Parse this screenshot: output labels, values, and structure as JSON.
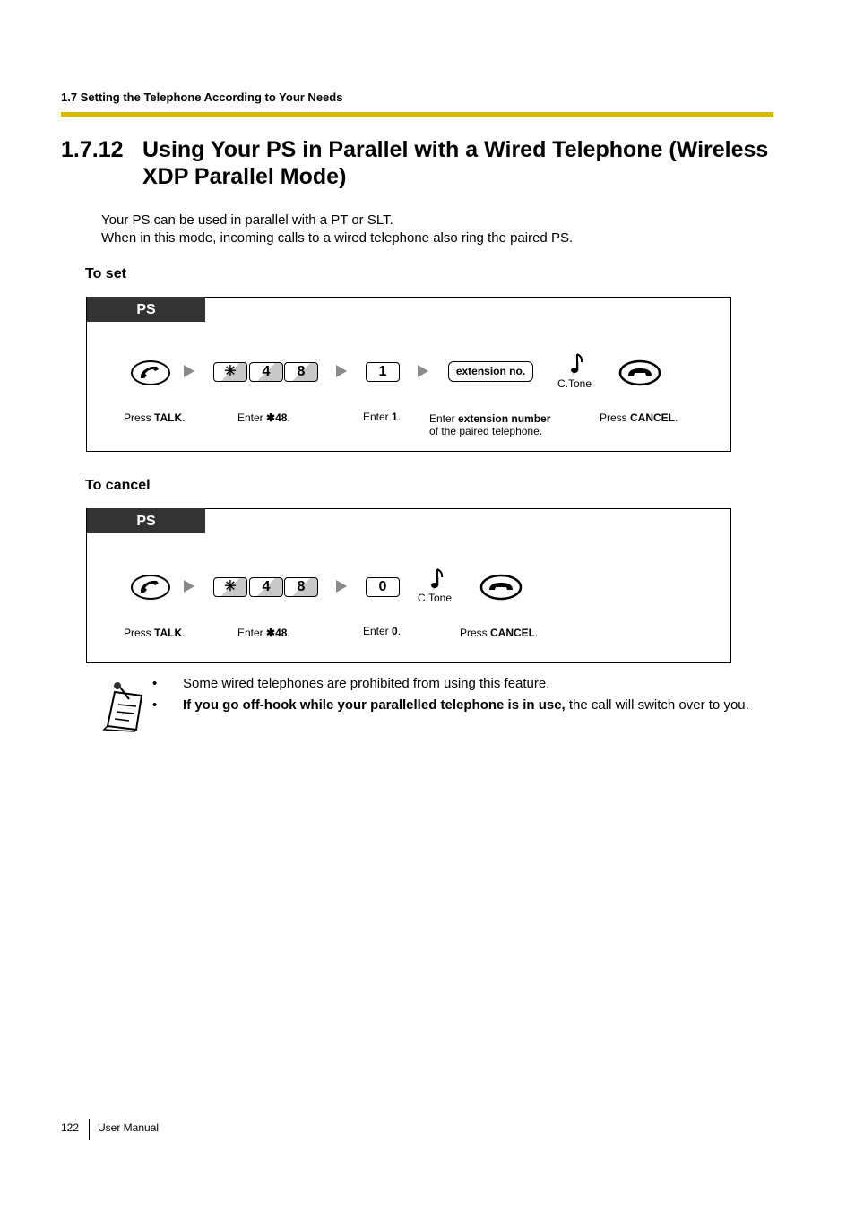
{
  "running_head": "1.7 Setting the Telephone According to Your Needs",
  "section": {
    "number": "1.7.12",
    "title": "Using Your PS in Parallel with a Wired Telephone (Wireless XDP Parallel Mode)"
  },
  "intro": [
    "Your PS can be used in parallel with a PT or SLT.",
    "When in this mode, incoming calls to a wired telephone also ring the paired PS."
  ],
  "set": {
    "heading": "To set",
    "tab": "PS",
    "keys": {
      "star": "✳",
      "four": "4",
      "eight": "8",
      "one": "1",
      "ext": "extension no."
    },
    "ctone": "C.Tone",
    "captions": {
      "talk_pre": "Press ",
      "talk_bold": "TALK",
      "talk_post": ".",
      "star_pre": "Enter ",
      "star_bold": "✱48",
      "star_post": ".",
      "one_pre": "Enter ",
      "one_bold": "1",
      "one_post": ".",
      "ext_pre": "Enter ",
      "ext_bold": "extension number",
      "ext_line2": "of the paired telephone.",
      "cancel_pre": "Press ",
      "cancel_bold": "CANCEL",
      "cancel_post": "."
    }
  },
  "cancel": {
    "heading": "To cancel",
    "tab": "PS",
    "keys": {
      "star": "✳",
      "four": "4",
      "eight": "8",
      "zero": "0"
    },
    "ctone": "C.Tone",
    "captions": {
      "talk_pre": "Press ",
      "talk_bold": "TALK",
      "talk_post": ".",
      "star_pre": "Enter ",
      "star_bold": "✱48",
      "star_post": ".",
      "zero_pre": "Enter ",
      "zero_bold": "0",
      "zero_post": ".",
      "cancel_pre": "Press ",
      "cancel_bold": "CANCEL",
      "cancel_post": "."
    }
  },
  "notes": [
    {
      "bullet": "•",
      "text": "Some wired telephones are prohibited from using this feature."
    },
    {
      "bullet": "•",
      "bold": "If you go off-hook while your parallelled telephone is in use,",
      "text": " the call will switch over to you."
    }
  ],
  "footer": {
    "page": "122",
    "label": "User Manual"
  },
  "colors": {
    "accent_rule": "#d9b800",
    "tab_bg": "#333333"
  }
}
